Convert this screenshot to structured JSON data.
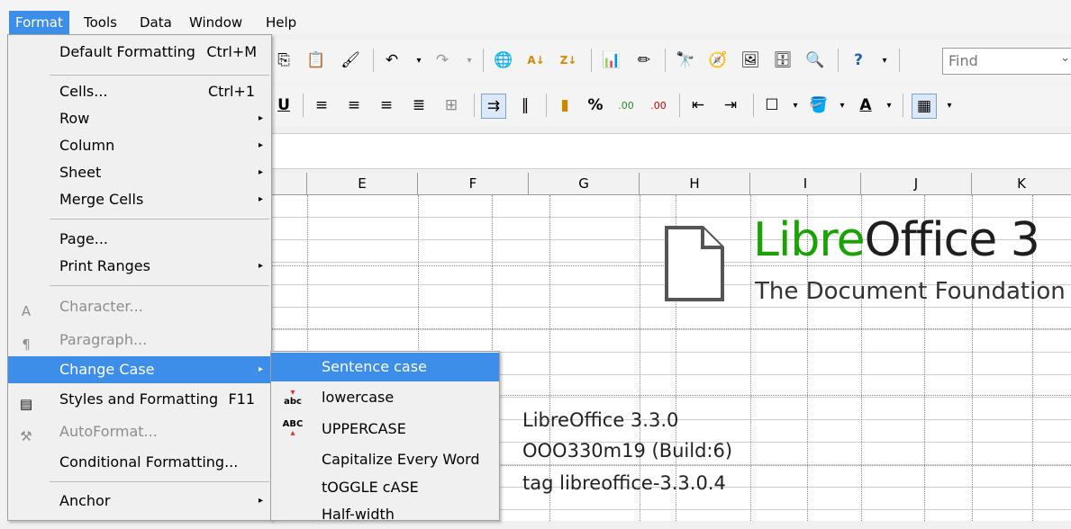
{
  "menubar": {
    "items": [
      "Format",
      "Tools",
      "Data",
      "Window",
      "Help"
    ]
  },
  "toolbar": {
    "find_placeholder": "Find"
  },
  "columns": [
    "E",
    "F",
    "G",
    "H",
    "I",
    "J",
    "K"
  ],
  "sheet": {
    "logo_green": "Libre",
    "logo_dark": "Office 3",
    "logo_sub": "The Document Foundation",
    "line1": "LibreOffice 3.3.0",
    "line2": "OOO330m19 (Build:6)",
    "line3": "tag libreoffice-3.3.0.4"
  },
  "format_menu": {
    "default_formatting": "Default Formatting",
    "default_formatting_acc": "Ctrl+M",
    "cells": "Cells...",
    "cells_acc": "Ctrl+1",
    "row": "Row",
    "column": "Column",
    "sheet": "Sheet",
    "merge_cells": "Merge Cells",
    "page": "Page...",
    "print_ranges": "Print Ranges",
    "character": "Character...",
    "paragraph": "Paragraph...",
    "change_case": "Change Case",
    "styles_formatting": "Styles and Formatting",
    "styles_formatting_acc": "F11",
    "autoformat": "AutoFormat...",
    "conditional_formatting": "Conditional Formatting...",
    "anchor": "Anchor"
  },
  "case_menu": {
    "sentence": "Sentence case",
    "lower": "lowercase",
    "upper": "UPPERCASE",
    "capitalize": "Capitalize Every Word",
    "toggle": "tOGGLE cASE",
    "halfwidth": "Half-width"
  },
  "colors": {
    "highlight": "#3d8ee8",
    "logo_green": "#18a303"
  }
}
